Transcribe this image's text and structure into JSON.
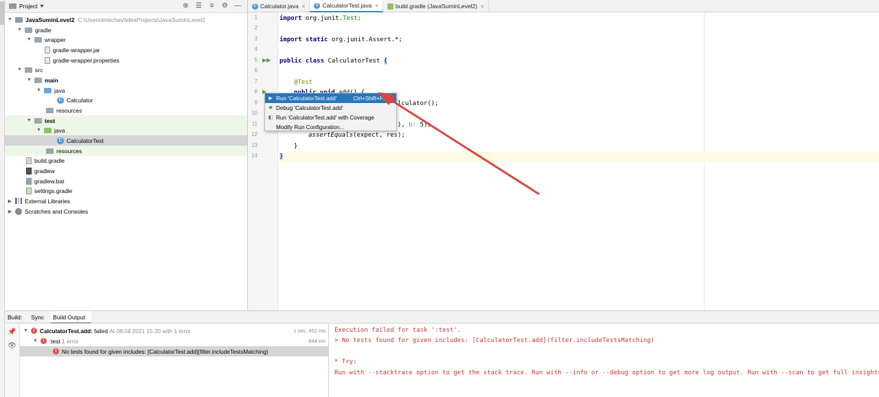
{
  "project_panel": {
    "title": "Project",
    "tree": [
      {
        "label": "JavaSuminLevel2",
        "path": "C:\\Users\\imitchev\\IdeaProjects\\JavaSuminLevel2"
      },
      {
        "label": "gradle"
      },
      {
        "label": "wrapper"
      },
      {
        "label": "gradle-wrapper.jar"
      },
      {
        "label": "gradle-wrapper.properties"
      },
      {
        "label": "src"
      },
      {
        "label": "main"
      },
      {
        "label": "java"
      },
      {
        "label": "Calculator"
      },
      {
        "label": "resources"
      },
      {
        "label": "test"
      },
      {
        "label": "java"
      },
      {
        "label": "CalculatorTest"
      },
      {
        "label": "resources"
      },
      {
        "label": "build.gradle"
      },
      {
        "label": "gradlew"
      },
      {
        "label": "gradlew.bat"
      },
      {
        "label": "settings.gradle"
      },
      {
        "label": "External Libraries"
      },
      {
        "label": "Scratches and Consoles"
      }
    ]
  },
  "editor": {
    "tabs": [
      {
        "label": "Calculator.java"
      },
      {
        "label": "CalculatorTest.java"
      },
      {
        "label": "build.gradle (JavaSuminLevel2)"
      }
    ],
    "line_numbers": [
      "1",
      "2",
      "3",
      "4",
      "5",
      "6",
      "7",
      "8",
      "9",
      "10",
      "11",
      "12",
      "13",
      "14"
    ],
    "code": {
      "l1_kw": "import",
      "l1_rest": " org.junit.",
      "l1_end": "Test;",
      "l3_kw": "import static",
      "l3_rest": " org.junit.Assert.*;",
      "l5_kw": "public class",
      "l5_rest": " CalculatorTest ",
      "l5_brace": "{",
      "l7": "@Test",
      "l8_kw": "public void",
      "l8_rest": " add() {",
      "l9": "lculator();",
      "l11_a": "), ",
      "l11_hint": "b:",
      "l11_b": " 5);",
      "l12_it": "assertEquals",
      "l12_rest": "(expect, res);",
      "l13": "}",
      "l14": "}"
    }
  },
  "popup": {
    "items": [
      {
        "label": "Run 'CalculatorTest.add'",
        "shortcut": "Ctrl+Shift+F10"
      },
      {
        "label": "Debug 'CalculatorTest.add'",
        "shortcut": ""
      },
      {
        "label": "Run 'CalculatorTest.add' with Coverage",
        "shortcut": ""
      },
      {
        "label": "Modify Run Configuration...",
        "shortcut": ""
      }
    ]
  },
  "build": {
    "tabs": {
      "build": "Build:",
      "sync": "Sync",
      "output": "Build Output"
    },
    "tree": [
      {
        "label": "CalculatorTest.add:",
        "status": "failed",
        "meta": "At 08.04.2021 15:20 with 1 error",
        "time": "1 sec, 452 ms"
      },
      {
        "label": ":test",
        "meta": "1 error",
        "time": "844 ms"
      },
      {
        "label": "No tests found for given includes: [CalculatorTest.add](filter.includeTestsMatching)"
      }
    ],
    "output": [
      "Execution failed for task ':test'.",
      "> No tests found for given includes: [CalculatorTest.add](filter.includeTestsMatching)",
      "",
      "* Try:",
      "Run with --stacktrace option to get the stack trace. Run with --info or --debug option to get more log output. Run with --scan to get full insights."
    ]
  },
  "colors": {
    "selection": "#2675bf",
    "error": "#c0392b",
    "annotation_arrow": "#d9473a"
  }
}
